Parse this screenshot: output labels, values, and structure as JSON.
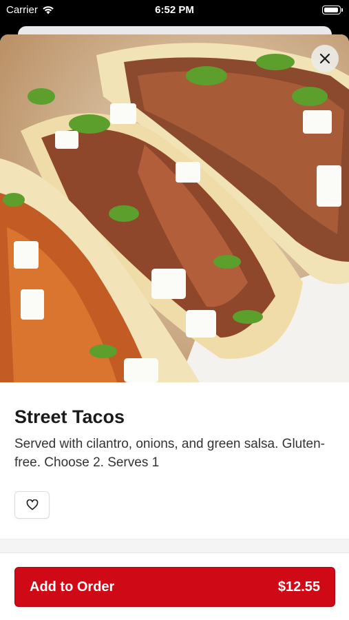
{
  "status_bar": {
    "carrier": "Carrier",
    "time": "6:52 PM"
  },
  "item": {
    "name": "Street Tacos",
    "description": "Served with cilantro, onions, and green salsa. Gluten-free. Choose 2. Serves 1",
    "image_icon": "food-photo"
  },
  "actions": {
    "close_icon": "close-icon",
    "favorite_icon": "heart-icon",
    "add_label": "Add to Order",
    "price": "$12.55"
  },
  "colors": {
    "accent": "#cf0a16",
    "text": "#1a1a1a"
  }
}
